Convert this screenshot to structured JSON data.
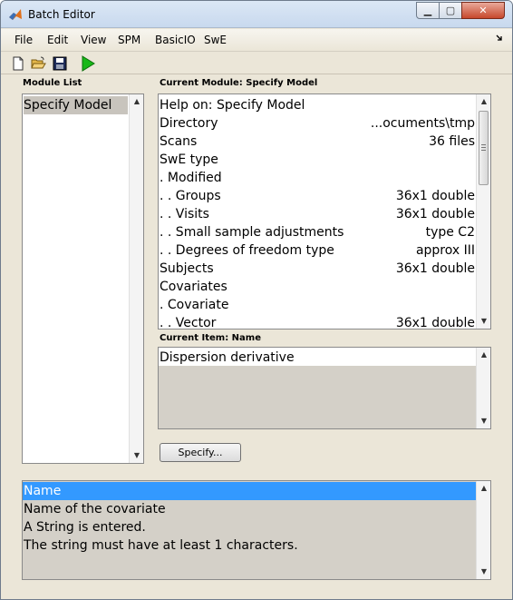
{
  "window": {
    "title": "Batch Editor",
    "controls": {
      "minimize": "▁",
      "maximize": "▢",
      "close": "✕"
    }
  },
  "menu": {
    "items": [
      "File",
      "Edit",
      "View",
      "SPM",
      "BasicIO",
      "SwE"
    ],
    "overflow_icon": "arrow-corner-icon"
  },
  "toolbar": {
    "icons": [
      "new-file-icon",
      "open-folder-icon",
      "save-icon",
      "run-icon"
    ],
    "run_color": "#18b818"
  },
  "module_list": {
    "label": "Module List",
    "items": [
      "Specify Model"
    ],
    "selected_index": 0
  },
  "current_module": {
    "label": "Current Module: Specify Model",
    "rows": [
      {
        "name": "Help on: Specify Model",
        "value": ""
      },
      {
        "name": "Directory",
        "value": "...ocuments\\tmp"
      },
      {
        "name": "Scans",
        "value": "36 files"
      },
      {
        "name": "SwE type",
        "value": ""
      },
      {
        "name": ". Modified",
        "value": ""
      },
      {
        "name": ". . Groups",
        "value": "36x1 double"
      },
      {
        "name": ". . Visits",
        "value": "36x1 double"
      },
      {
        "name": ". . Small sample adjustments",
        "value": "type C2"
      },
      {
        "name": ". . Degrees of freedom type",
        "value": "approx III"
      },
      {
        "name": "Subjects",
        "value": "36x1 double"
      },
      {
        "name": "Covariates",
        "value": ""
      },
      {
        "name": ". Covariate",
        "value": ""
      },
      {
        "name": ". . Vector",
        "value": "36x1 double"
      }
    ]
  },
  "current_item": {
    "label": "Current Item: Name",
    "value": "Dispersion derivative"
  },
  "specify_button": "Specify...",
  "help": {
    "lines": [
      "Name",
      "Name of the covariate",
      "A String is entered.",
      "The string must have at least 1 characters."
    ],
    "selected_index": 0
  },
  "colors": {
    "window_bg": "#ebe6d8",
    "selection_blue": "#3399ff",
    "selection_gray": "#c8c4bd",
    "disabled_bg": "#d4d0c8"
  }
}
